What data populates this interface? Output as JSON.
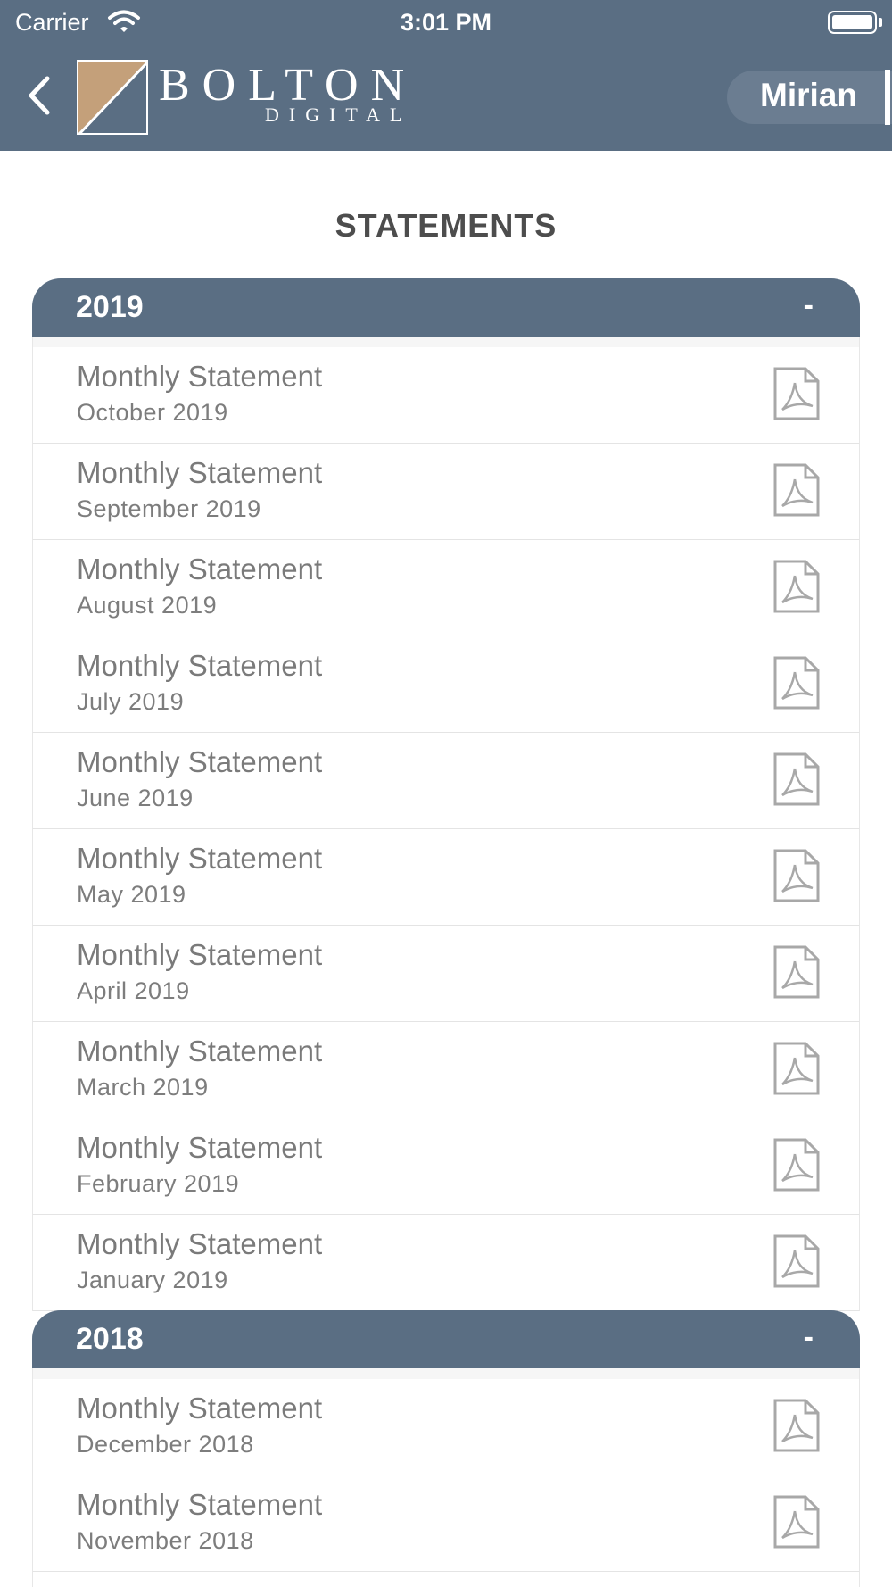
{
  "status_bar": {
    "carrier": "Carrier",
    "time": "3:01 PM"
  },
  "header": {
    "brand_name": "BOLTON",
    "brand_sub": "DIGITAL",
    "user_name": "Mirian"
  },
  "page": {
    "title": "STATEMENTS"
  },
  "colors": {
    "header_bg": "#5a6e83",
    "logo_gold": "#c4a07a",
    "text_gray": "#7a7a7a"
  },
  "sections": [
    {
      "year": "2019",
      "toggle": "-",
      "items": [
        {
          "title": "Monthly Statement",
          "period": "October 2019"
        },
        {
          "title": "Monthly Statement",
          "period": "September 2019"
        },
        {
          "title": "Monthly Statement",
          "period": "August 2019"
        },
        {
          "title": "Monthly Statement",
          "period": "July 2019"
        },
        {
          "title": "Monthly Statement",
          "period": "June 2019"
        },
        {
          "title": "Monthly Statement",
          "period": "May 2019"
        },
        {
          "title": "Monthly Statement",
          "period": "April 2019"
        },
        {
          "title": "Monthly Statement",
          "period": "March 2019"
        },
        {
          "title": "Monthly Statement",
          "period": "February 2019"
        },
        {
          "title": "Monthly Statement",
          "period": "January 2019"
        }
      ]
    },
    {
      "year": "2018",
      "toggle": "-",
      "items": [
        {
          "title": "Monthly Statement",
          "period": "December 2018"
        },
        {
          "title": "Monthly Statement",
          "period": "November 2018"
        }
      ]
    }
  ]
}
